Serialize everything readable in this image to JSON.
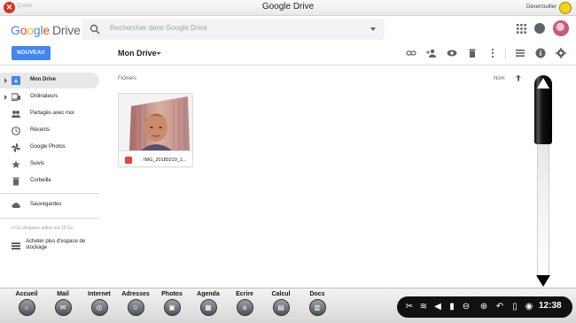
{
  "window": {
    "close_label": "Quitter",
    "title": "Google Drive",
    "user_label": "Déverrouiller"
  },
  "header": {
    "logo_letters": [
      "G",
      "o",
      "o",
      "g",
      "l",
      "e"
    ],
    "logo_product": "Drive",
    "search_placeholder": "Rechercher dans Google Drive"
  },
  "toolbar": {
    "new_label": "NOUVEAU",
    "location": "Mon Drive"
  },
  "sidebar": {
    "items": [
      {
        "label": "Mon Drive",
        "icon": "drive-icon"
      },
      {
        "label": "Ordinateurs",
        "icon": "computers-icon"
      },
      {
        "label": "Partagés avec moi",
        "icon": "shared-icon"
      },
      {
        "label": "Récents",
        "icon": "clock-icon"
      },
      {
        "label": "Google Photos",
        "icon": "photos-icon"
      },
      {
        "label": "Suivis",
        "icon": "star-icon"
      },
      {
        "label": "Corbeille",
        "icon": "trash-icon"
      },
      {
        "label": "Sauvegardes",
        "icon": "cloud-icon"
      }
    ],
    "quota": "2 Go d'espace utilisé sur 15 Go",
    "buy_storage": "Acheter plus d'espace de stockage"
  },
  "main": {
    "section_label": "Fichiers",
    "sort_label": "Nom",
    "files": [
      {
        "name": "IMG_20180219_1...",
        "type": "image"
      }
    ]
  },
  "dock": {
    "apps": [
      "Accueil",
      "Mail",
      "Internet",
      "Adresses",
      "Photos",
      "Agenda",
      "Ecrire",
      "Calcul",
      "Docs"
    ],
    "clock": "12:38"
  },
  "colors": {
    "accent": "#4285f4",
    "file_type": "#ea4335"
  }
}
